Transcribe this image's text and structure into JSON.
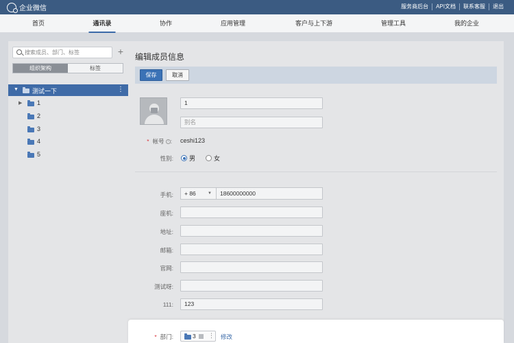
{
  "app": {
    "title": "企业微信",
    "top_links": [
      "服务商后台",
      "API文档",
      "联系客服",
      "退出"
    ]
  },
  "nav": {
    "items": [
      "首页",
      "通讯录",
      "协作",
      "应用管理",
      "客户与上下游",
      "管理工具",
      "我的企业"
    ],
    "active": "通讯录"
  },
  "sidebar": {
    "search_placeholder": "搜索成员、部门、标签",
    "add_symbol": "+",
    "tabs": [
      "组织架构",
      "标签"
    ],
    "active_tab": "组织架构",
    "tree_root": "测试一下",
    "tree_items": [
      {
        "label": "1",
        "has_children": true
      },
      {
        "label": "2",
        "has_children": false
      },
      {
        "label": "3",
        "has_children": false
      },
      {
        "label": "4",
        "has_children": false
      },
      {
        "label": "5",
        "has_children": false
      }
    ]
  },
  "form": {
    "title": "编辑成员信息",
    "save_label": "保存",
    "cancel_label": "取消",
    "name_value": "1",
    "alias_placeholder": "别名",
    "account_label": "帐号",
    "account_value": "ceshi123",
    "gender_label": "性别:",
    "gender_options": [
      "男",
      "女"
    ],
    "gender_selected": "男",
    "phone_label": "手机:",
    "phone_country_code": "+ 86",
    "phone_value": "18600000000",
    "landline_label": "座机:",
    "address_label": "地址:",
    "email_label": "邮箱:",
    "website_label": "官网:",
    "custom_label": "测试呀:",
    "field111_label": "111:",
    "field111_value": "123",
    "dept_label": "部门:",
    "dept_value": "3",
    "dept_edit_label": "修改"
  },
  "colors": {
    "topbar": "#3b5b82",
    "accent": "#3b72b6",
    "required": "#d9363e"
  }
}
